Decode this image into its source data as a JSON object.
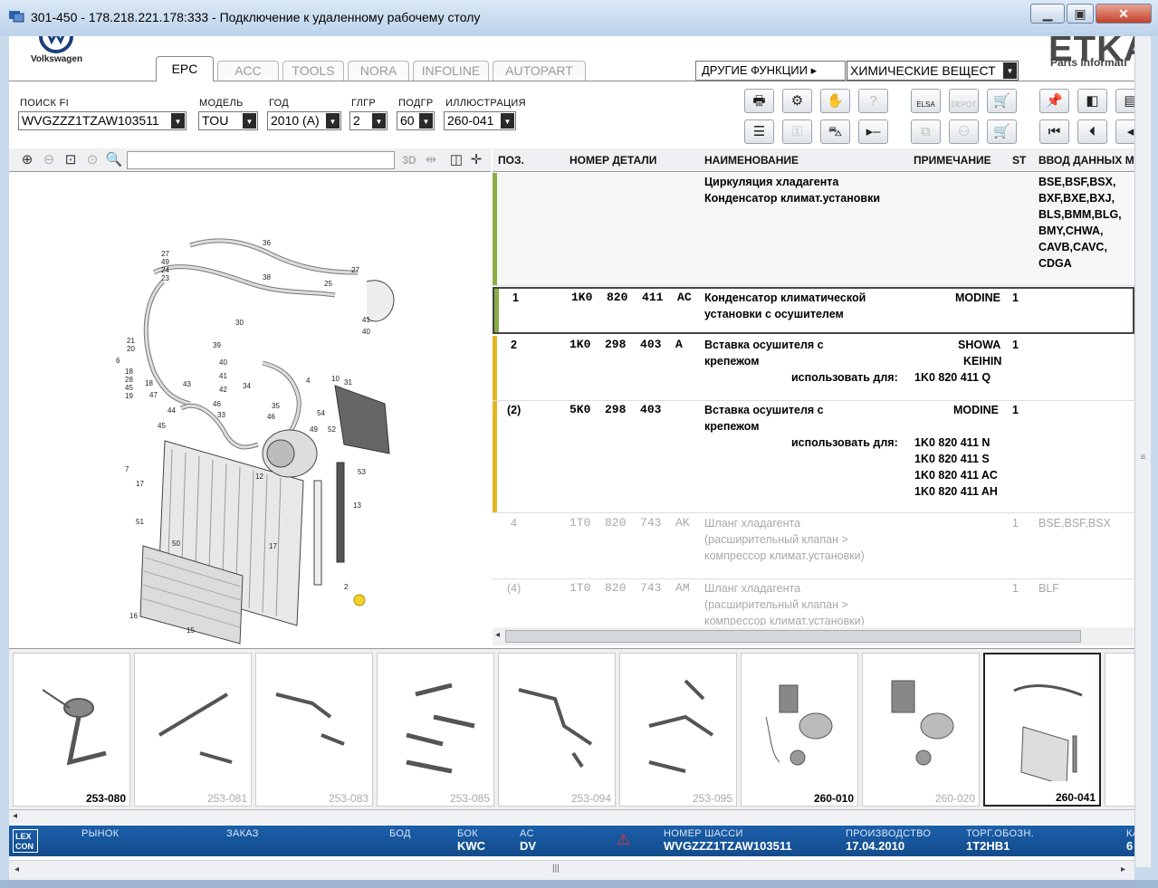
{
  "window": {
    "title": "301-450 - 178.218.221.178:333 - Подключение к удаленному рабочему столу",
    "min_icon": "minimize-icon",
    "max_icon": "maximize-icon",
    "close_icon": "close-icon"
  },
  "brand": {
    "vw_label": "Volkswagen",
    "etka_logo": "ETKA",
    "etka_sub": "Parts Informati"
  },
  "tabs": [
    {
      "label": "EPC",
      "active": true
    },
    {
      "label": "ACC"
    },
    {
      "label": "TOOLS"
    },
    {
      "label": "NORA"
    },
    {
      "label": "INFOLINE"
    },
    {
      "label": "AUTOPART"
    }
  ],
  "other_functions": {
    "label": "ДРУГИЕ ФУНКЦИИ",
    "selected": "ХИМИЧЕСКИЕ ВЕЩЕСТ"
  },
  "filters": [
    {
      "label": "ПОИСК FI",
      "value": "WVGZZZ1TZAW103511"
    },
    {
      "label": "МОДЕЛЬ",
      "value": "TOU"
    },
    {
      "label": "ГОД",
      "value": "2010 (A)"
    },
    {
      "label": "ГЛГР",
      "value": "2"
    },
    {
      "label": "ПОДГР",
      "value": "60"
    },
    {
      "label": "ИЛЛЮСТРАЦИЯ",
      "value": "260-041"
    }
  ],
  "toolbar_labels": {
    "elsa": "ELSA",
    "depot": "DEPOT"
  },
  "table": {
    "headers": [
      "ПОЗ.",
      "НОМЕР ДЕТАЛИ",
      "НАИМЕНОВАНИЕ",
      "ПРИМЕЧАНИЕ",
      "ST",
      "ВВОД ДАННЫХ М"
    ],
    "group": {
      "name1": "Циркуляция хладагента",
      "name2": "Конденсатор климат.установки",
      "data": [
        "BSE,BSF,BSX,",
        "BXF,BXE,BXJ,",
        "BLS,BMM,BLG,",
        "BMY,CHWA,",
        "CAVB,CAVC,",
        "CDGA"
      ]
    },
    "rows": [
      {
        "pos": "1",
        "part": "1K0  820  411  AC",
        "name1": "Конденсатор климатической",
        "name2": "установки с осушителем",
        "note": "MODINE",
        "st": "1"
      },
      {
        "pos": "2",
        "part": "1K0  298  403  A",
        "name1": "Вставка осушителя с",
        "name2": "крепежом",
        "note1": "SHOWA",
        "note2": "KEIHIN",
        "st": "1",
        "use_label": "использовать для:",
        "use": [
          "1K0 820 411 Q"
        ]
      },
      {
        "pos": "(2)",
        "part": "5K0  298  403",
        "name1": "Вставка осушителя с",
        "name2": "крепежом",
        "note": "MODINE",
        "st": "1",
        "use_label": "использовать для:",
        "use": [
          "1K0 820 411 N",
          "1K0 820 411 S",
          "1K0 820 411 AC",
          "1K0 820 411 AH"
        ]
      },
      {
        "pos": "4",
        "part": "1T0  820  743  AK",
        "name1": "Шланг хладагента",
        "name2": "(расширительный клапан >",
        "name3": "компрессор климат.установки)",
        "st": "1",
        "data": "BSE,BSF,BSX"
      },
      {
        "pos": "(4)",
        "part": "1T0  820  743  AM",
        "name1": "Шланг хладагента",
        "name2": "(расширительный клапан >",
        "name3": "компрессор климат.установки)",
        "st": "1",
        "data": "BLF"
      }
    ]
  },
  "thumbnails": [
    {
      "label": "253-080",
      "bold": true
    },
    {
      "label": "253-081"
    },
    {
      "label": "253-083"
    },
    {
      "label": "253-085"
    },
    {
      "label": "253-094"
    },
    {
      "label": "253-095"
    },
    {
      "label": "260-010",
      "bold": true
    },
    {
      "label": "260-020"
    },
    {
      "label": "260-041",
      "bold": true,
      "selected": true
    }
  ],
  "status": {
    "logo": "LEX CON",
    "items": [
      {
        "label": "РЫНОК",
        "value": ""
      },
      {
        "label": "ЗАКАЗ",
        "value": ""
      },
      {
        "label": "БОД",
        "value": ""
      },
      {
        "label": "БОК",
        "value": "KWC"
      },
      {
        "label": "AC",
        "value": "DV"
      },
      {
        "label": "НОМЕР ШАССИ",
        "value": "WVGZZZ1TZAW103511"
      },
      {
        "label": "ПРОИЗВОДСТВО",
        "value": "17.04.2010"
      },
      {
        "label": "ТОРГ.ОБОЗН.",
        "value": "1T2HB1"
      },
      {
        "label": "КА",
        "value": "6"
      }
    ]
  },
  "colors": {
    "accent_green": "#8aac45",
    "accent_yellow": "#e2b623",
    "status_blue": "#1b5faa"
  }
}
